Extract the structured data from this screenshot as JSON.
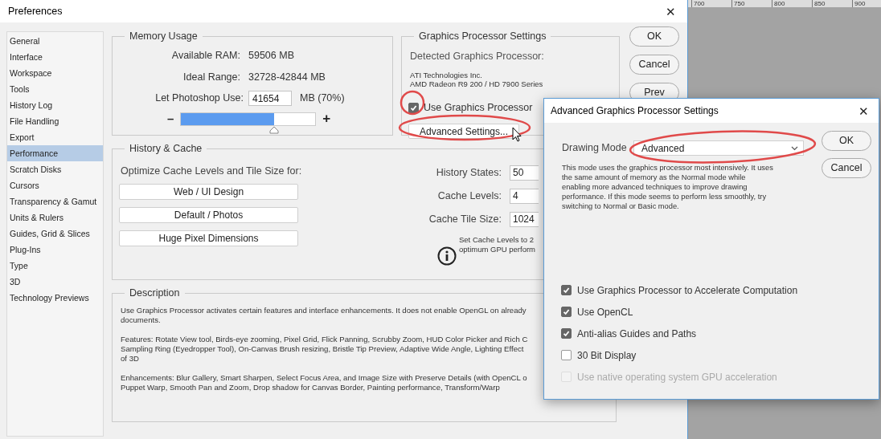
{
  "window": {
    "title": "Preferences",
    "close": "✕"
  },
  "ruler": {
    "labels": [
      "700",
      "750",
      "800",
      "850",
      "900"
    ]
  },
  "sidebar": {
    "items": [
      {
        "label": "General",
        "selected": false
      },
      {
        "label": "Interface",
        "selected": false
      },
      {
        "label": "Workspace",
        "selected": false
      },
      {
        "label": "Tools",
        "selected": false
      },
      {
        "label": "History Log",
        "selected": false
      },
      {
        "label": "File Handling",
        "selected": false
      },
      {
        "label": "Export",
        "selected": false
      },
      {
        "label": "Performance",
        "selected": true
      },
      {
        "label": "Scratch Disks",
        "selected": false
      },
      {
        "label": "Cursors",
        "selected": false
      },
      {
        "label": "Transparency & Gamut",
        "selected": false
      },
      {
        "label": "Units & Rulers",
        "selected": false
      },
      {
        "label": "Guides, Grid & Slices",
        "selected": false
      },
      {
        "label": "Plug-Ins",
        "selected": false
      },
      {
        "label": "Type",
        "selected": false
      },
      {
        "label": "3D",
        "selected": false
      },
      {
        "label": "Technology Previews",
        "selected": false
      }
    ]
  },
  "memory_usage": {
    "title": "Memory Usage",
    "rows": [
      {
        "label": "Available RAM:",
        "value": "59506 MB"
      },
      {
        "label": "Ideal Range:",
        "value": "32728-42844 MB"
      }
    ],
    "use": {
      "label": "Let Photoshop Use:",
      "value": "41654",
      "suffix": "MB (70%)"
    },
    "slider": {
      "minus": "–",
      "plus": "+",
      "level": 0.69
    }
  },
  "gpu": {
    "title": "Graphics Processor Settings",
    "detected_label": "Detected Graphics Processor:",
    "detected": [
      "ATI Technologies Inc.",
      "AMD Radeon R9 200 / HD 7900 Series"
    ],
    "use_gpu": {
      "label": "Use Graphics Processor",
      "checked": true
    },
    "advanced_button": "Advanced Settings..."
  },
  "buttons": [
    "OK",
    "Cancel",
    "Prev"
  ],
  "history_cache": {
    "title": "History & Cache",
    "optimize_label": "Optimize Cache Levels and Tile Size for:",
    "presets": [
      "Web / UI Design",
      "Default / Photos",
      "Huge Pixel Dimensions"
    ],
    "fields": [
      {
        "label": "History States:",
        "value": "50"
      },
      {
        "label": "Cache Levels:",
        "value": "4"
      },
      {
        "label": "Cache Tile Size:",
        "value": "1024"
      }
    ],
    "note": [
      "Set Cache Levels to 2",
      "optimum GPU perform"
    ]
  },
  "description": {
    "title": "Description",
    "paragraphs": [
      [
        "Use Graphics Processor activates certain features and interface enhancements. It does not enable OpenGL on already",
        "documents."
      ],
      [
        "Features: Rotate View tool, Birds-eye zooming, Pixel Grid, Flick Panning, Scrubby Zoom, HUD Color Picker and Rich C",
        "Sampling Ring (Eyedropper Tool), On-Canvas Brush resizing, Bristle Tip Preview, Adaptive Wide Angle, Lighting Effect",
        "of 3D"
      ],
      [
        "Enhancements: Blur Gallery, Smart Sharpen, Select Focus Area, and Image Size with Preserve Details (with OpenCL o",
        "Puppet Warp, Smooth Pan and Zoom, Drop shadow for Canvas Border, Painting performance, Transform/Warp"
      ]
    ]
  },
  "advanced_dialog": {
    "title": "Advanced Graphics Processor Settings",
    "close": "✕",
    "drawing_mode": {
      "label": "Drawing Mode",
      "value": "Advanced"
    },
    "explanation": [
      "This mode uses the graphics processor most intensively.  It uses",
      "the same amount of memory as the Normal mode while",
      "enabling more advanced techniques to improve drawing",
      "performance.  If this mode seems to perform less smoothly, try",
      "switching to Normal or Basic mode."
    ],
    "buttons": [
      "OK",
      "Cancel"
    ],
    "options": [
      {
        "label": "Use Graphics Processor to Accelerate Computation",
        "checked": true,
        "disabled": false
      },
      {
        "label": "Use OpenCL",
        "checked": true,
        "disabled": false
      },
      {
        "label": "Anti-alias Guides and Paths",
        "checked": true,
        "disabled": false
      },
      {
        "label": "30 Bit Display",
        "checked": false,
        "disabled": false
      },
      {
        "label": "Use native operating system GPU acceleration",
        "checked": false,
        "disabled": true
      }
    ]
  }
}
